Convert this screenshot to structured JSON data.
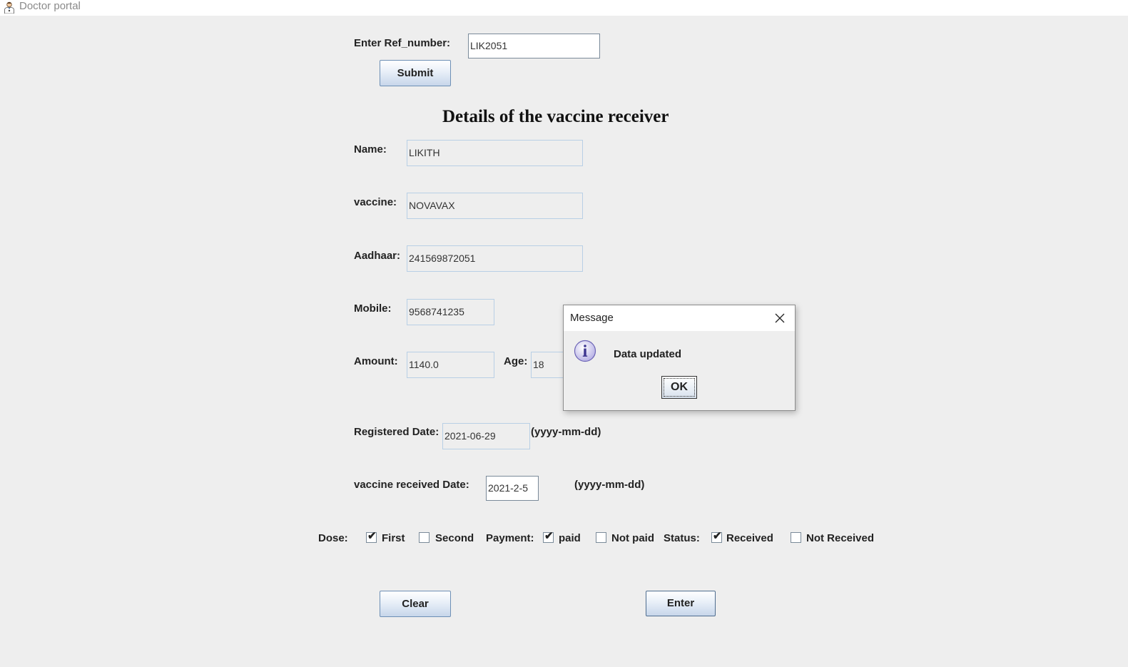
{
  "window": {
    "title": "Doctor portal",
    "icon": "doctor-icon"
  },
  "ref": {
    "label": "Enter Ref_number:",
    "value": "LIK2051",
    "submit_label": "Submit"
  },
  "heading": "Details of the vaccine receiver",
  "fields": {
    "name": {
      "label": "Name:",
      "value": "LIKITH"
    },
    "vaccine": {
      "label": "vaccine:",
      "value": "NOVAVAX"
    },
    "aadhaar": {
      "label": "Aadhaar:",
      "value": "241569872051"
    },
    "mobile": {
      "label": "Mobile:",
      "value": "9568741235"
    },
    "amount": {
      "label": "Amount:",
      "value": "1140.0"
    },
    "age": {
      "label": "Age:",
      "value": "18"
    },
    "registered_date": {
      "label": "Registered Date:",
      "value": "2021-06-29",
      "hint": "(yyyy-mm-dd)"
    },
    "received_date": {
      "label": "vaccine received Date:",
      "value": "2021-2-5",
      "hint": "(yyyy-mm-dd)"
    }
  },
  "options": {
    "dose": {
      "label": "Dose:",
      "first": {
        "label": "First",
        "checked": true
      },
      "second": {
        "label": "Second",
        "checked": false
      }
    },
    "payment": {
      "label": "Payment:",
      "paid": {
        "label": "paid",
        "checked": true
      },
      "not_paid": {
        "label": "Not paid",
        "checked": false
      }
    },
    "status": {
      "label": "Status:",
      "received": {
        "label": "Received",
        "checked": true
      },
      "not_received": {
        "label": "Not Received",
        "checked": false
      }
    },
    "check_mark": "✔"
  },
  "buttons": {
    "clear": "Clear",
    "enter": "Enter"
  },
  "dialog": {
    "title": "Message",
    "message": "Data updated",
    "ok": "OK",
    "icon": "info-icon"
  }
}
